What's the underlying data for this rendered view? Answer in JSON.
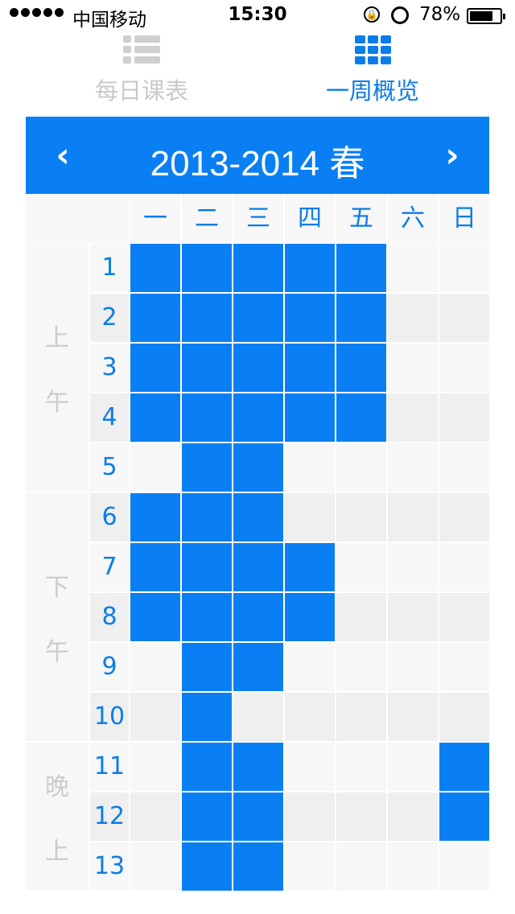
{
  "status_bar": {
    "carrier": "中国移动",
    "time": "15:30",
    "battery_percent": "78%",
    "battery_level": 0.78,
    "icons": [
      "signal-dots-icon",
      "orientation-lock-icon",
      "alarm-icon",
      "battery-icon"
    ]
  },
  "tabs": [
    {
      "label": "每日课表",
      "icon": "list-icon",
      "active": false
    },
    {
      "label": "一周概览",
      "icon": "grid-icon",
      "active": true
    }
  ],
  "term": {
    "title": "2013-2014 春",
    "prev_icon": "chevron-left-icon",
    "next_icon": "chevron-right-icon"
  },
  "days": [
    "一",
    "二",
    "三",
    "四",
    "五",
    "六",
    "日"
  ],
  "periods": [
    "1",
    "2",
    "3",
    "4",
    "5",
    "6",
    "7",
    "8",
    "9",
    "10",
    "11",
    "12",
    "13"
  ],
  "sections": [
    {
      "label": "上午",
      "chars": [
        "上",
        "午"
      ],
      "periods": 5
    },
    {
      "label": "下午",
      "chars": [
        "下",
        "午"
      ],
      "periods": 5
    },
    {
      "label": "晚上",
      "chars": [
        "晚",
        "上"
      ],
      "periods": 3
    }
  ],
  "occupied": [
    [
      1,
      1,
      1,
      1,
      1,
      0,
      0
    ],
    [
      1,
      1,
      1,
      1,
      1,
      0,
      0
    ],
    [
      1,
      1,
      1,
      1,
      1,
      0,
      0
    ],
    [
      1,
      1,
      1,
      1,
      1,
      0,
      0
    ],
    [
      0,
      1,
      1,
      0,
      0,
      0,
      0
    ],
    [
      1,
      1,
      1,
      0,
      0,
      0,
      0
    ],
    [
      1,
      1,
      1,
      1,
      0,
      0,
      0
    ],
    [
      1,
      1,
      1,
      1,
      0,
      0,
      0
    ],
    [
      0,
      1,
      1,
      0,
      0,
      0,
      0
    ],
    [
      0,
      1,
      0,
      0,
      0,
      0,
      0
    ],
    [
      0,
      1,
      1,
      0,
      0,
      0,
      1
    ],
    [
      0,
      1,
      1,
      0,
      0,
      0,
      1
    ],
    [
      0,
      1,
      1,
      0,
      0,
      0,
      0
    ]
  ],
  "colors": {
    "accent": "#0a7ff3",
    "text_accent": "#0b7de8",
    "inactive": "#c9c9c9",
    "cell_light": "#f7f7f7",
    "cell_dark": "#efefef",
    "side_label": "#cccccc"
  }
}
